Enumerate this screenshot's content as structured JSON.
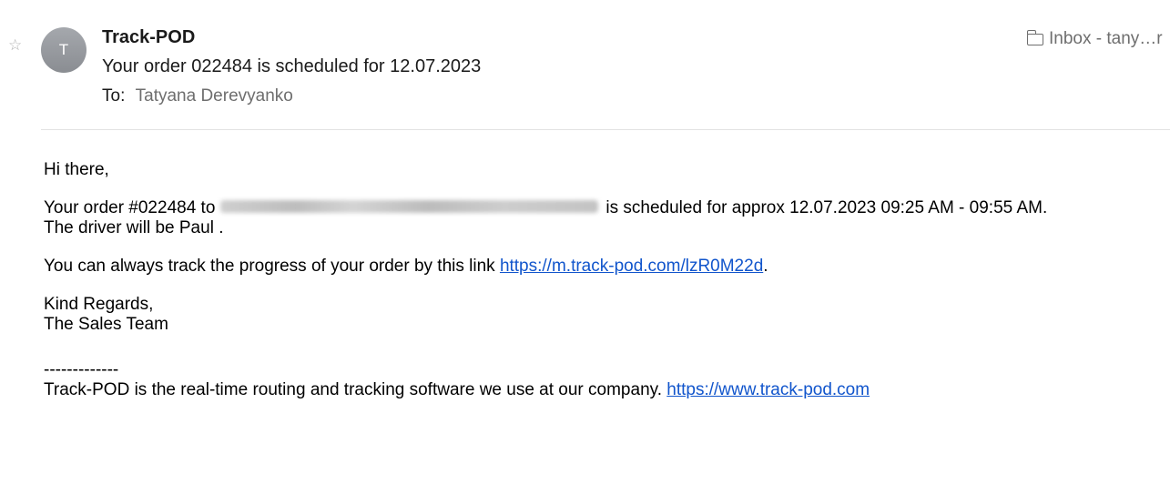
{
  "header": {
    "star_icon": "☆",
    "avatar_initial": "T",
    "sender": "Track-POD",
    "subject": "Your order 022484 is scheduled for 12.07.2023",
    "to_label": "To:",
    "to_name": "Tatyana Derevyanko",
    "mailbox": "Inbox - tany…r"
  },
  "body": {
    "greeting": "Hi there,",
    "order_prefix": "Your order #022484 to",
    "order_suffix": "is scheduled for approx 12.07.2023 09:25 AM - 09:55 AM.",
    "driver_line": "The driver will be Paul .",
    "track_prefix": "You can always track the progress of your order by this link",
    "track_link": "https://m.track-pod.com/lzR0M22d",
    "track_suffix": ".",
    "regards": "Kind Regards,",
    "team": "The Sales Team",
    "separator": "-------------",
    "footer_text": "Track-POD is the real-time routing and tracking software we use at our company.",
    "footer_link": "https://www.track-pod.com"
  },
  "colors": {
    "link": "#1155cc",
    "muted": "#6e6e6e"
  }
}
